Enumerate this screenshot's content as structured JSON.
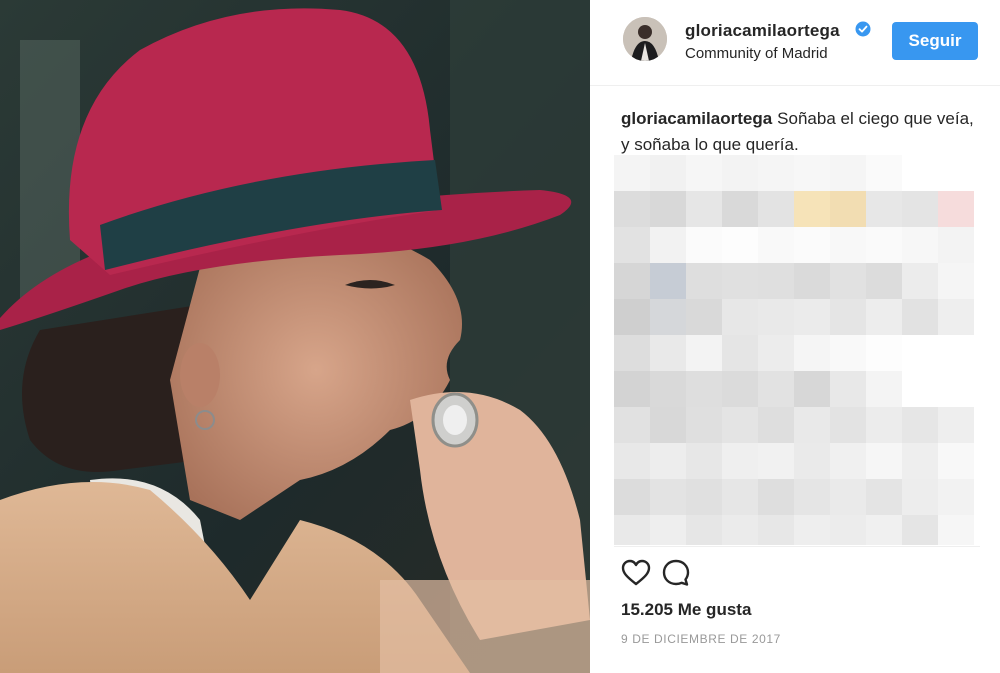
{
  "post": {
    "username": "gloriacamilaortega",
    "location": "Community of Madrid",
    "follow_label": "Seguir",
    "caption_user": "gloriacamilaortega",
    "caption_text": "Soñaba el ciego que veía, y soñaba lo que quería.",
    "likes": "15.205 Me gusta",
    "date": "9 DE DICIEMBRE DE 2017"
  },
  "icons": {
    "verified": "verified-badge-icon",
    "like": "heart-icon",
    "comment": "comment-bubble-icon"
  },
  "colors": {
    "follow_button": "#3897f0",
    "hat": "#b8284f",
    "hat_band": "#1f3f45",
    "sweater": "#d7ae8a"
  }
}
